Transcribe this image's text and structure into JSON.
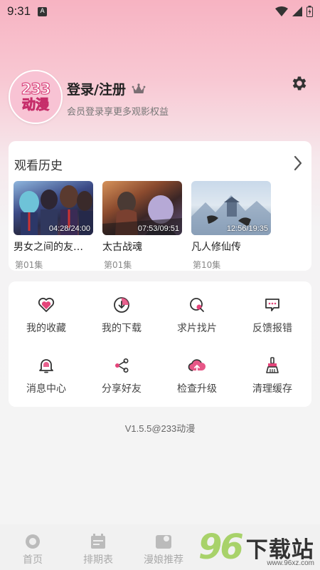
{
  "status": {
    "time": "9:31",
    "a_badge": "A"
  },
  "profile": {
    "avatar_line1": "233",
    "avatar_line2": "动漫",
    "login_label": "登录/注册",
    "subtitle": "会员登录享更多观影权益"
  },
  "history": {
    "title": "观看历史",
    "videos": [
      {
        "title": "男女之间的友…",
        "duration": "04:28/24:00",
        "episode": "第01集"
      },
      {
        "title": "太古战魂",
        "duration": "07:53/09:51",
        "episode": "第01集"
      },
      {
        "title": "凡人修仙传",
        "duration": "12:56/19:35",
        "episode": "第10集"
      }
    ]
  },
  "menu": {
    "items": [
      {
        "label": "我的收藏",
        "icon": "heart-icon"
      },
      {
        "label": "我的下载",
        "icon": "download-icon"
      },
      {
        "label": "求片找片",
        "icon": "search-film-icon"
      },
      {
        "label": "反馈报错",
        "icon": "feedback-icon"
      },
      {
        "label": "消息中心",
        "icon": "bell-icon"
      },
      {
        "label": "分享好友",
        "icon": "share-icon"
      },
      {
        "label": "检查升级",
        "icon": "upgrade-cloud-icon"
      },
      {
        "label": "清理缓存",
        "icon": "broom-icon"
      }
    ]
  },
  "version": "V1.5.5@233动漫",
  "nav": {
    "items": [
      {
        "label": "首页",
        "icon": "home-icon"
      },
      {
        "label": "排期表",
        "icon": "calendar-icon"
      },
      {
        "label": "漫娘推荐",
        "icon": "recommend-icon"
      }
    ]
  },
  "watermark": {
    "number": "96",
    "text": "下载站",
    "url": "www.96xz.com"
  },
  "colors": {
    "accent": "#e4457a",
    "bg_top": "#f7b3c2",
    "icon_dark": "#333333"
  }
}
